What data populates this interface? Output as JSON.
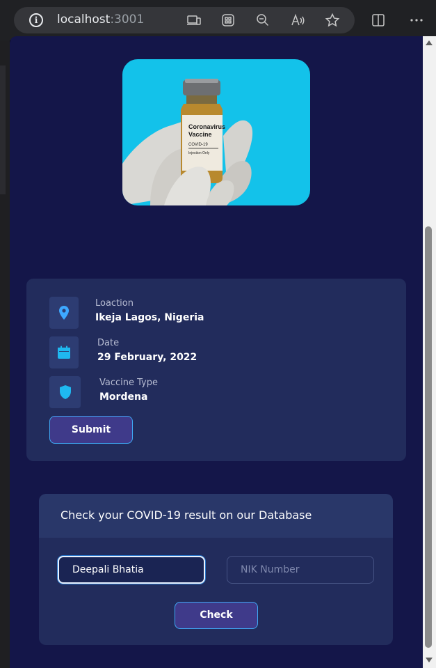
{
  "browser": {
    "url_host": "localhost",
    "url_port": ":3001",
    "icons": [
      "info-icon",
      "device-icon",
      "apps-icon",
      "zoom-out-icon",
      "read-aloud-icon",
      "favorite-star-icon",
      "split-screen-icon",
      "more-icon"
    ]
  },
  "hero": {
    "image_label": [
      "Coronavirus",
      "Vaccine",
      "COVID-19",
      "Injection Only"
    ],
    "background": "#13c2ea"
  },
  "info": {
    "location_label": "Loaction",
    "location_value": "Ikeja Lagos, Nigeria",
    "date_label": "Date",
    "date_value": "29 February, 2022",
    "vaccine_label": "Vaccine Type",
    "vaccine_value": "Mordena",
    "submit_label": "Submit"
  },
  "check": {
    "title": "Check your COVID-19 result on our Database",
    "name_value": "Deepali Bhatia",
    "nik_placeholder": "NIK Number",
    "check_label": "Check"
  },
  "colors": {
    "page_bg": "#141649",
    "card_bg": "#222c5c",
    "accent": "#3fa9f5",
    "button_bg": "#3f3a8a",
    "icon_color": "#1fb8f0"
  }
}
